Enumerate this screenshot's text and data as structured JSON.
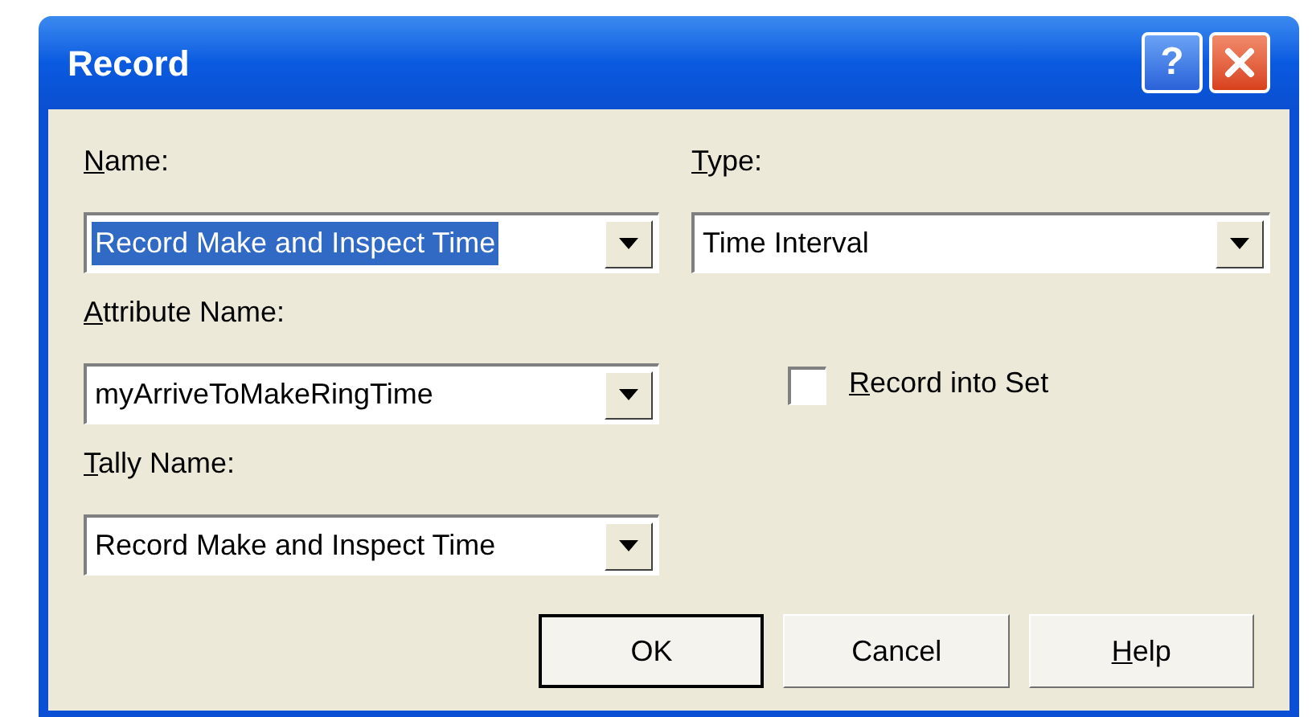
{
  "window": {
    "title": "Record",
    "help_button": "?"
  },
  "fields": [
    {
      "label": "Name:",
      "value": "Record Make and Inspect Time",
      "text_selected": true
    },
    {
      "label": "Type:",
      "value": "Time Interval",
      "text_selected": false
    },
    {
      "label": "Attribute Name:",
      "value": "myArriveToMakeRingTime",
      "text_selected": false
    },
    {
      "label": "Tally Name:",
      "value": "Record Make and Inspect Time",
      "text_selected": false
    }
  ],
  "checkbox": {
    "label": "Record into Set",
    "checked": false
  },
  "buttons": [
    {
      "label": "OK",
      "default": true,
      "mnemonic": false
    },
    {
      "label": "Cancel",
      "default": false,
      "mnemonic": false
    },
    {
      "label": "Help",
      "default": false,
      "mnemonic": true
    }
  ]
}
